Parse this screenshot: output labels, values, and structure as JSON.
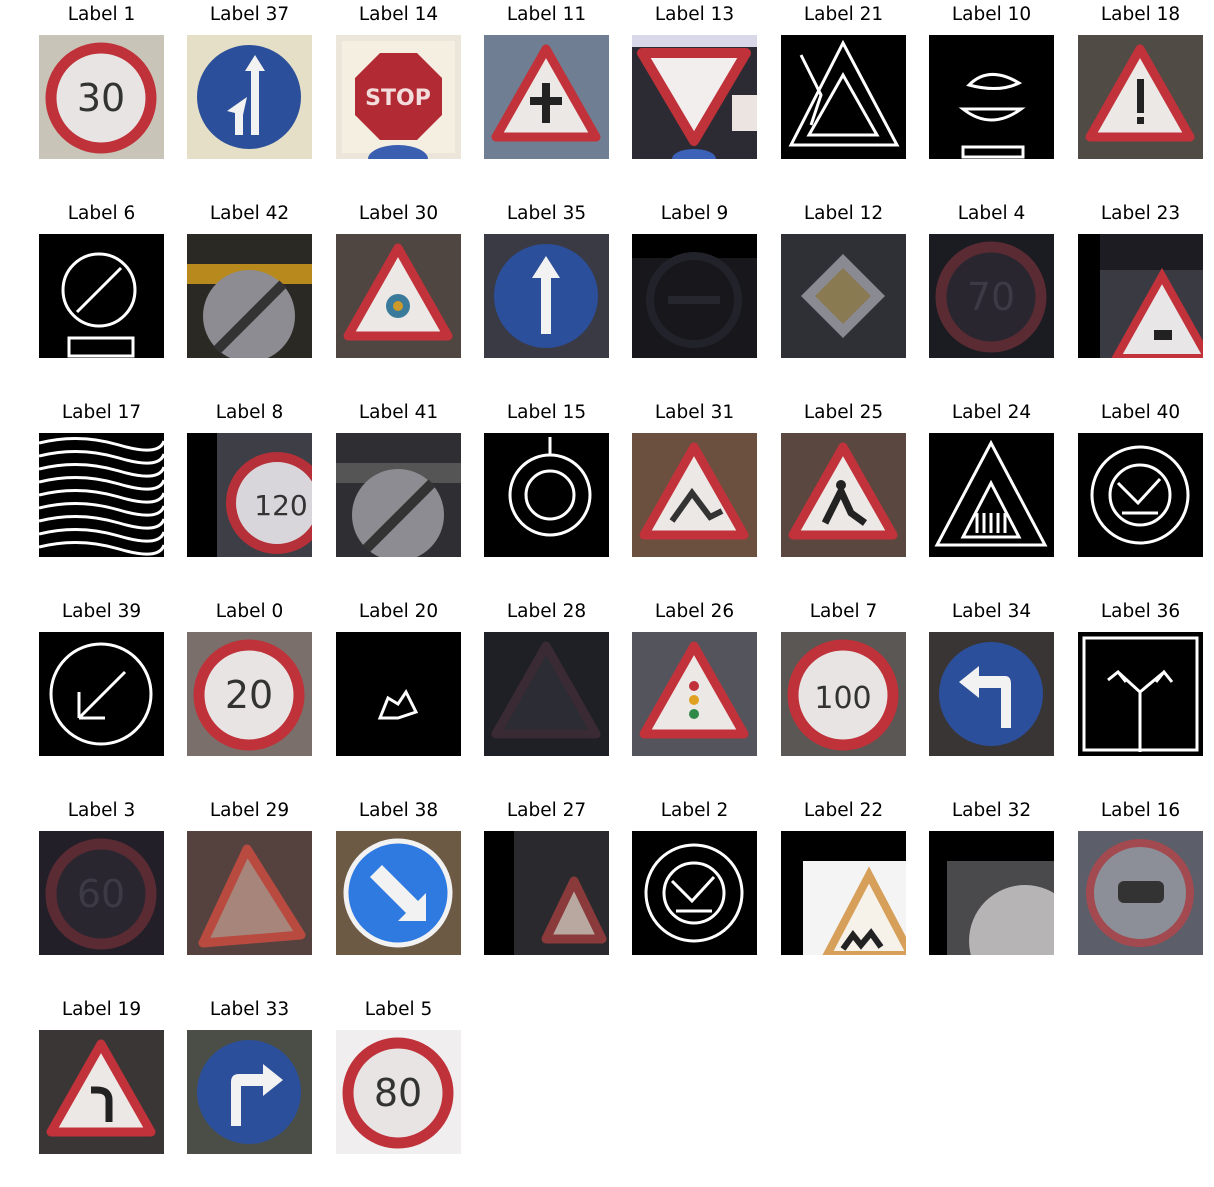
{
  "grid": {
    "columns": 8,
    "tiles": [
      {
        "label": "Label 1",
        "kind": "speed",
        "text": "30",
        "bg": "#c9c4b8"
      },
      {
        "label": "Label 37",
        "kind": "blue-arrow",
        "arrow": "straight-left",
        "bg": "#e4dfc6"
      },
      {
        "label": "Label 14",
        "kind": "stop",
        "text": "STOP",
        "bg": "#ece6da"
      },
      {
        "label": "Label 11",
        "kind": "triangle",
        "inner": "cross",
        "bg": "#6f7e92"
      },
      {
        "label": "Label 13",
        "kind": "yield",
        "bg": "#2c2a33"
      },
      {
        "label": "Label 21",
        "kind": "edge",
        "shape": "triangle"
      },
      {
        "label": "Label 10",
        "kind": "edge",
        "shape": "blob"
      },
      {
        "label": "Label 18",
        "kind": "triangle",
        "inner": "exclaim",
        "bg": "#504b45"
      },
      {
        "label": "Label 6",
        "kind": "edge",
        "shape": "slash-circle"
      },
      {
        "label": "Label 42",
        "kind": "end-restriction",
        "bg": "#2a2924",
        "accent": "#b88a1e"
      },
      {
        "label": "Label 30",
        "kind": "triangle",
        "inner": "snow",
        "bg": "#4f4541"
      },
      {
        "label": "Label 35",
        "kind": "blue-arrow",
        "arrow": "up",
        "bg": "#3a3a45"
      },
      {
        "label": "Label 9",
        "kind": "dark-circle",
        "bg": "#17171c"
      },
      {
        "label": "Label 12",
        "kind": "diamond",
        "bg": "#2f2f36"
      },
      {
        "label": "Label 4",
        "kind": "speed-dark",
        "text": "70",
        "bg": "#1b1b22"
      },
      {
        "label": "Label 23",
        "kind": "triangle-partial",
        "bg": "#1c1c22"
      },
      {
        "label": "Label 17",
        "kind": "edge",
        "shape": "noise"
      },
      {
        "label": "Label 8",
        "kind": "speed-partial",
        "text": "120",
        "bg": "#3e3e46"
      },
      {
        "label": "Label 41",
        "kind": "end-restriction",
        "bg": "#2f2f33",
        "accent": "#555"
      },
      {
        "label": "Label 15",
        "kind": "edge",
        "shape": "ring"
      },
      {
        "label": "Label 31",
        "kind": "triangle",
        "inner": "deer",
        "bg": "#6b5040"
      },
      {
        "label": "Label 25",
        "kind": "triangle",
        "inner": "work",
        "bg": "#5a4740"
      },
      {
        "label": "Label 24",
        "kind": "edge",
        "shape": "triangle-hatch"
      },
      {
        "label": "Label 40",
        "kind": "edge",
        "shape": "round-noise"
      },
      {
        "label": "Label 39",
        "kind": "edge",
        "shape": "arrow"
      },
      {
        "label": "Label 0",
        "kind": "speed",
        "text": "20",
        "bg": "#7a6f6a"
      },
      {
        "label": "Label 20",
        "kind": "edge",
        "shape": "small"
      },
      {
        "label": "Label 28",
        "kind": "triangle-dark",
        "bg": "#1f1f26"
      },
      {
        "label": "Label 26",
        "kind": "triangle",
        "inner": "lights",
        "bg": "#54545c"
      },
      {
        "label": "Label 7",
        "kind": "speed",
        "text": "100",
        "bg": "#5a5754"
      },
      {
        "label": "Label 34",
        "kind": "blue-arrow",
        "arrow": "left",
        "bg": "#3a3535"
      },
      {
        "label": "Label 36",
        "kind": "edge",
        "shape": "fork"
      },
      {
        "label": "Label 3",
        "kind": "speed-dark",
        "text": "60",
        "bg": "#231f28"
      },
      {
        "label": "Label 29",
        "kind": "triangle-tilt",
        "bg": "#55423e"
      },
      {
        "label": "Label 38",
        "kind": "blue-arrow",
        "arrow": "down-right",
        "bg": "#6c5a44"
      },
      {
        "label": "Label 27",
        "kind": "triangle-small",
        "bg": "#2a2a2e"
      },
      {
        "label": "Label 2",
        "kind": "edge",
        "shape": "round-noise"
      },
      {
        "label": "Label 22",
        "kind": "triangle-bottom",
        "bg": "#f4f4f4"
      },
      {
        "label": "Label 32",
        "kind": "end-partial",
        "bg": "#4a4a4c"
      },
      {
        "label": "Label 16",
        "kind": "no-trucks",
        "bg": "#5c5f6a"
      },
      {
        "label": "Label 19",
        "kind": "triangle",
        "inner": "curve",
        "bg": "#3a3636"
      },
      {
        "label": "Label 33",
        "kind": "blue-arrow",
        "arrow": "right",
        "bg": "#4a4e46"
      },
      {
        "label": "Label 5",
        "kind": "speed-light",
        "text": "80",
        "bg": "#f0eeee"
      }
    ]
  }
}
